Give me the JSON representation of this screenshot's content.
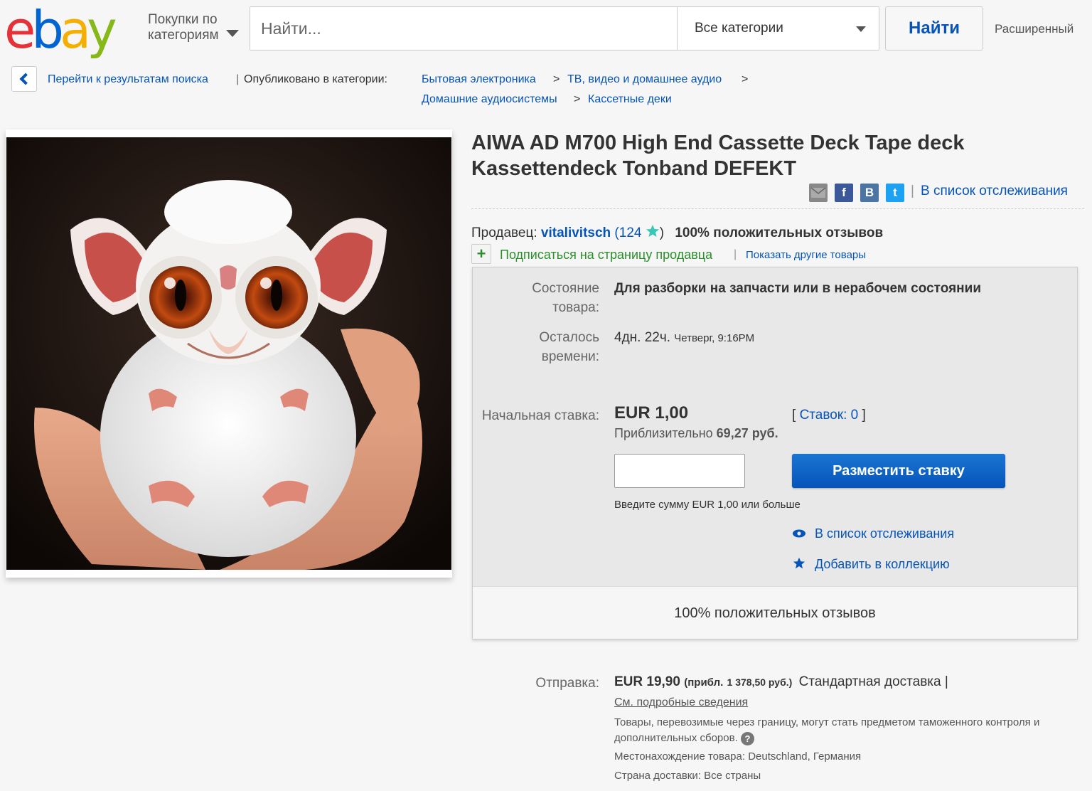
{
  "header": {
    "logo": {
      "e": "e",
      "b": "b",
      "a": "a",
      "y": "y"
    },
    "shop_by_category": "Покупки по категориям",
    "search_placeholder": "Найти...",
    "category_select": "Все категории",
    "search_button": "Найти",
    "advanced_link": "Расширенный"
  },
  "breadcrumb": {
    "back_to_results": "Перейти к результатам поиска",
    "separator": "|",
    "published_in": "Опубликовано в категории:",
    "items": [
      "Бытовая электроника",
      "ТВ, видео и домашнее аудио",
      "Домашние аудиосистемы",
      "Кассетные деки"
    ],
    "arrow": ">"
  },
  "item": {
    "title": "AIWA AD M700 High End Cassette Deck Tape deck Kassettendeck Tonband DEFEKT",
    "share_icons": [
      "email-icon",
      "facebook-icon",
      "vkontakte-icon",
      "twitter-icon"
    ],
    "share_labels": {
      "facebook": "f",
      "vk": "B",
      "twitter": "t"
    },
    "watch_link": "В список отслеживания",
    "watch_separator": "|"
  },
  "seller": {
    "label": "Продавец:",
    "name": "vitalivitsch",
    "feedback_count": "124",
    "open_paren": "(",
    "close_paren": ")",
    "positive": "100% положительных отзывов",
    "follow": "Подписаться на страницу продавца",
    "separator": "|",
    "other_items": "Показать другие товары"
  },
  "buybox": {
    "condition_label": "Состояние товара:",
    "condition_value": "Для разборки на запчасти или в нерабочем состоянии",
    "time_label": "Осталось времени:",
    "time_value": "4дн. 22ч.",
    "time_end": "Четверг, 9:16PM",
    "start_bid_label": "Начальная ставка:",
    "start_bid_value": "EUR 1,00",
    "approx_prefix": "Приблизительно",
    "approx_value": "69,27 руб.",
    "bids_open": "[",
    "bids_link": "Ставок: 0",
    "bids_close": "]",
    "bid_button": "Разместить ставку",
    "bid_hint": "Введите сумму EUR 1,00 или больше",
    "watch": "В список отслеживания",
    "collection": "Добавить в коллекцию",
    "footer": "100% положительных отзывов"
  },
  "shipping": {
    "label": "Отправка:",
    "price": "EUR 19,90",
    "approx": "(прибл.",
    "approx_value": "1 378,50 руб.)",
    "method": "Стандартная доставка |",
    "details_link": "См. подробные сведения",
    "customs_note": "Товары, перевозимые через границу, могут стать предметом таможенного контроля и дополнительных сборов.",
    "help": "?",
    "location_label": "Местонахождение товара:",
    "location_value": "Deutschland, Германия",
    "ships_to_label": "Страна доставки:",
    "ships_to_value": "Все страны"
  }
}
